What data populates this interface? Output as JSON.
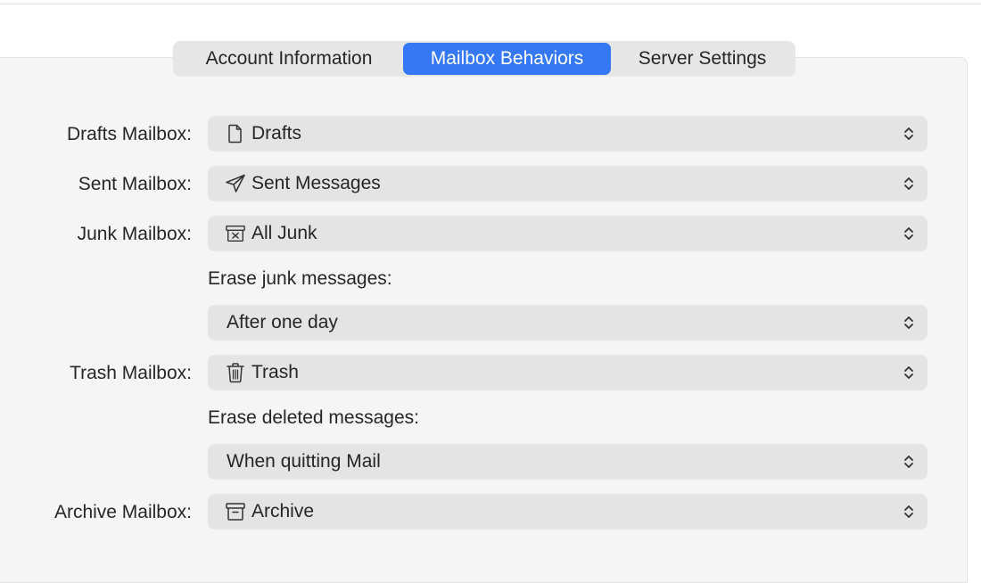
{
  "tabs": {
    "account_information": "Account Information",
    "mailbox_behaviors": "Mailbox Behaviors",
    "server_settings": "Server Settings",
    "selected": "Mailbox Behaviors"
  },
  "drafts": {
    "label": "Drafts Mailbox:",
    "value": "Drafts",
    "icon": "document-icon"
  },
  "sent": {
    "label": "Sent Mailbox:",
    "value": "Sent Messages",
    "icon": "paper-plane-icon"
  },
  "junk": {
    "label": "Junk Mailbox:",
    "value": "All Junk",
    "icon": "junk-tray-icon",
    "erase_label": "Erase junk messages:",
    "erase_value": "After one day"
  },
  "trash": {
    "label": "Trash Mailbox:",
    "value": "Trash",
    "icon": "trash-icon",
    "erase_label": "Erase deleted messages:",
    "erase_value": "When quitting Mail"
  },
  "archive": {
    "label": "Archive Mailbox:",
    "value": "Archive",
    "icon": "archive-box-icon"
  },
  "colors": {
    "accent": "#3478f6",
    "panel_bg": "#f5f5f5",
    "popup_bg": "#e4e4e4"
  }
}
